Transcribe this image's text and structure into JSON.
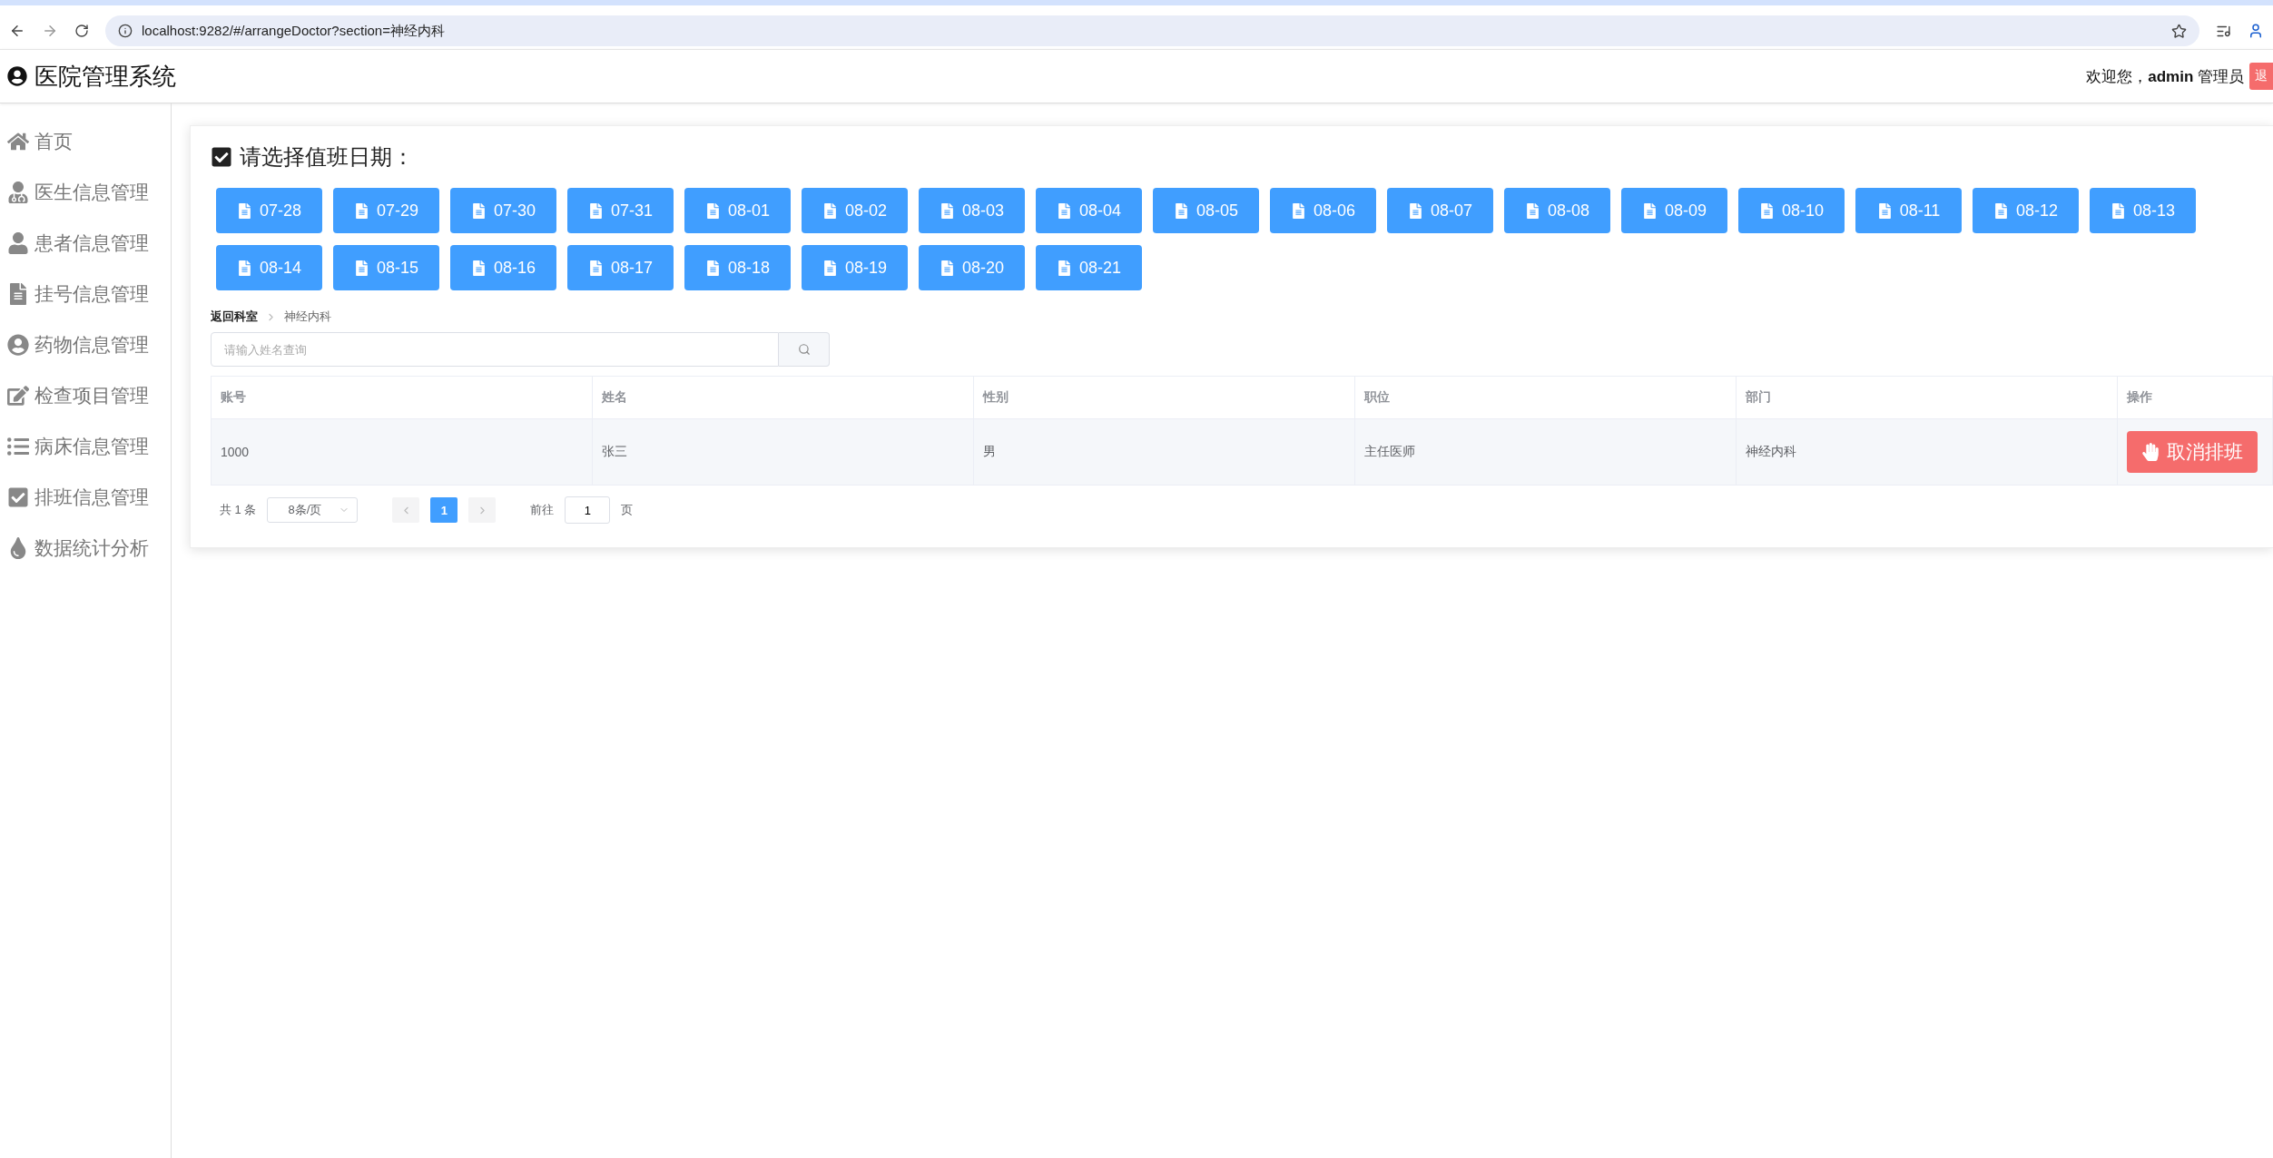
{
  "browser": {
    "url": "localhost:9282/#/arrangeDoctor?section=神经内科"
  },
  "header": {
    "title": "医院管理系统",
    "welcome": "欢迎您，",
    "user": "admin",
    "role": "管理员",
    "logout": "退"
  },
  "sidebar": {
    "items": [
      {
        "label": "首页"
      },
      {
        "label": "医生信息管理"
      },
      {
        "label": "患者信息管理"
      },
      {
        "label": "挂号信息管理"
      },
      {
        "label": "药物信息管理"
      },
      {
        "label": "检查项目管理"
      },
      {
        "label": "病床信息管理"
      },
      {
        "label": "排班信息管理"
      },
      {
        "label": "数据统计分析"
      }
    ]
  },
  "card": {
    "title": "请选择值班日期：",
    "dates": [
      "07-28",
      "07-29",
      "07-30",
      "07-31",
      "08-01",
      "08-02",
      "08-03",
      "08-04",
      "08-05",
      "08-06",
      "08-07",
      "08-08",
      "08-09",
      "08-10",
      "08-11",
      "08-12",
      "08-13",
      "08-14",
      "08-15",
      "08-16",
      "08-17",
      "08-18",
      "08-19",
      "08-20",
      "08-21"
    ],
    "breadcrumb": [
      "返回科室",
      "神经内科"
    ],
    "search": {
      "placeholder": "请输入姓名查询"
    },
    "table": {
      "columns": [
        "账号",
        "姓名",
        "性别",
        "职位",
        "部门",
        "操作"
      ],
      "rows": [
        {
          "cells": [
            "1000",
            "张三",
            "男",
            "主任医师",
            "神经内科"
          ],
          "action": "取消排班"
        }
      ]
    },
    "pagination": {
      "total": "共 1 条",
      "page_size": "8条/页",
      "pages": [
        {
          "label": "1",
          "selected": true
        }
      ],
      "goto": "前往",
      "goto_value": "1",
      "suffix": "页"
    }
  }
}
